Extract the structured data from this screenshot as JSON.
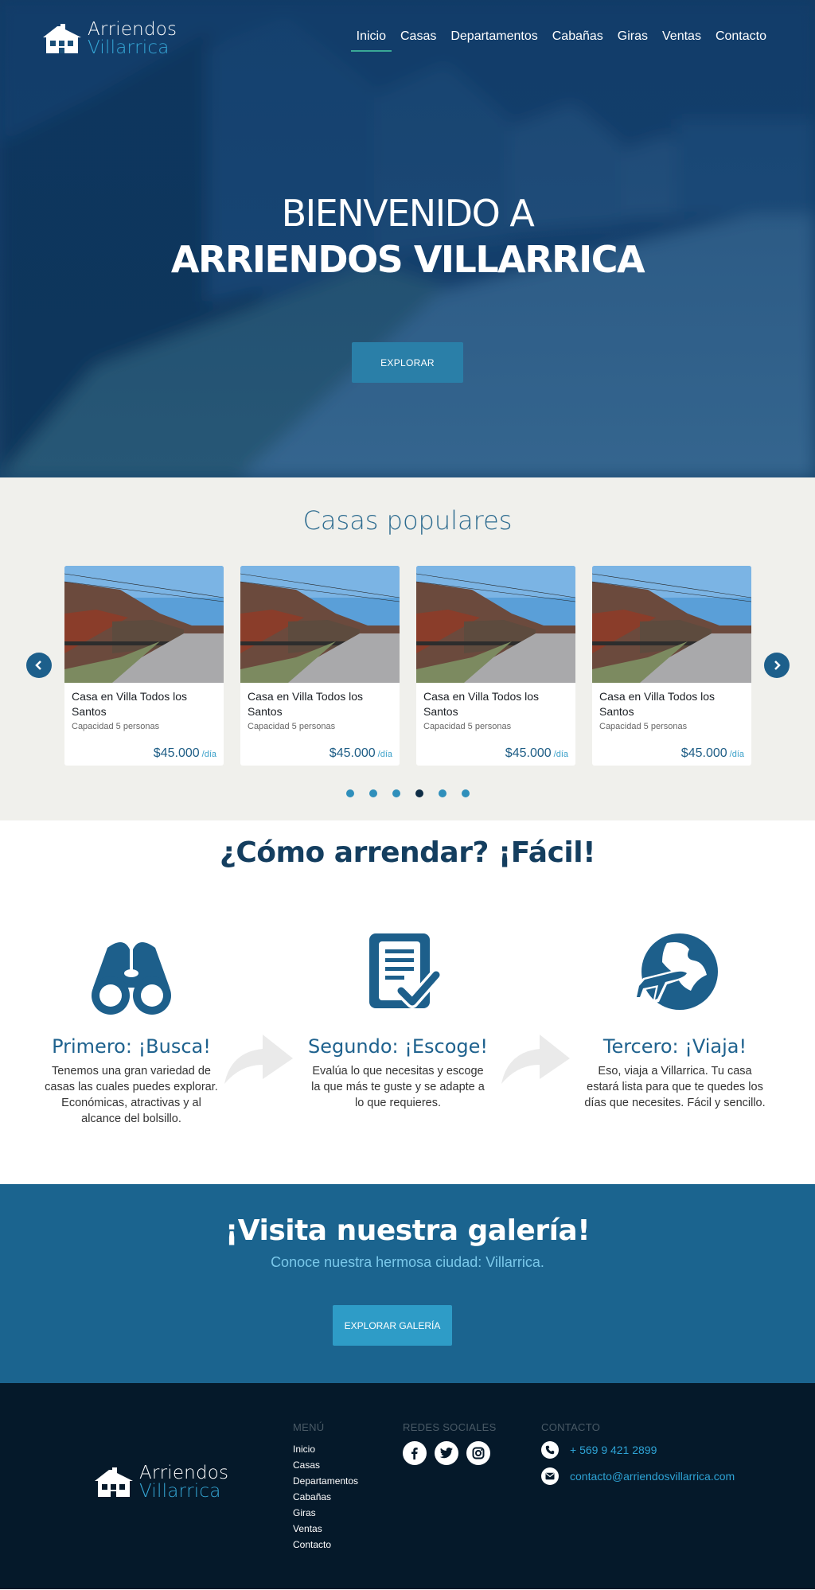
{
  "brand": {
    "line1": "Arriendos",
    "line2": "Villarrica"
  },
  "nav": {
    "items": [
      "Inicio",
      "Casas",
      "Departamentos",
      "Cabañas",
      "Giras",
      "Ventas",
      "Contacto"
    ],
    "active": "Inicio"
  },
  "hero": {
    "title_line1": "BIENVENIDO A",
    "title_line2": "ARRIENDOS VILLARRICA",
    "button": "EXPLORAR"
  },
  "popular": {
    "title": "Casas populares",
    "cards": [
      {
        "title": "Casa en Villa Todos los Santos",
        "capacity": "Capacidad 5 personas",
        "price": "$45.000",
        "unit": "/día"
      },
      {
        "title": "Casa en Villa Todos los Santos",
        "capacity": "Capacidad 5 personas",
        "price": "$45.000",
        "unit": "/día"
      },
      {
        "title": "Casa en Villa Todos los Santos",
        "capacity": "Capacidad 5 personas",
        "price": "$45.000",
        "unit": "/día"
      },
      {
        "title": "Casa en Villa Todos los Santos",
        "capacity": "Capacidad 5 personas",
        "price": "$45.000",
        "unit": "/día"
      }
    ],
    "dots_total": 6,
    "active_dot": 4
  },
  "how": {
    "title": "¿Cómo arrendar? ¡Fácil!",
    "steps": [
      {
        "title": "Primero: ¡Busca!",
        "desc": "Tenemos una gran variedad de casas las cuales puedes explorar. Económicas, atractivas y al alcance del bolsillo.",
        "icon": "binoculars-icon"
      },
      {
        "title": "Segundo: ¡Escoge!",
        "desc": "Evalúa lo que necesitas y escoge la que más te guste y se adapte a lo que requieres.",
        "icon": "document-check-icon"
      },
      {
        "title": "Tercero: ¡Viaja!",
        "desc": "Eso, viaja a Villarrica. Tu casa estará lista para que te quedes los días que necesites. Fácil y sencillo.",
        "icon": "globe-plane-icon"
      }
    ]
  },
  "gallery": {
    "title": "¡Visita nuestra galería!",
    "subtitle": "Conoce nuestra hermosa ciudad: Villarrica.",
    "button": "EXPLORAR GALERÍA"
  },
  "footer": {
    "menu_heading": "MENÚ",
    "menu": [
      "Inicio",
      "Casas",
      "Departamentos",
      "Cabañas",
      "Giras",
      "Ventas",
      "Contacto"
    ],
    "social_heading": "REDES SOCIALES",
    "socials": [
      "facebook-icon",
      "twitter-icon",
      "instagram-icon"
    ],
    "contact_heading": "CONTACTO",
    "phone": "+ 569 9 421 2899",
    "email": "contacto@arriendosvillarrica.com"
  },
  "colors": {
    "primary": "#1b648f",
    "accent": "#35a7d6",
    "dark": "#05192a",
    "light_bg": "#f0f0ec"
  }
}
